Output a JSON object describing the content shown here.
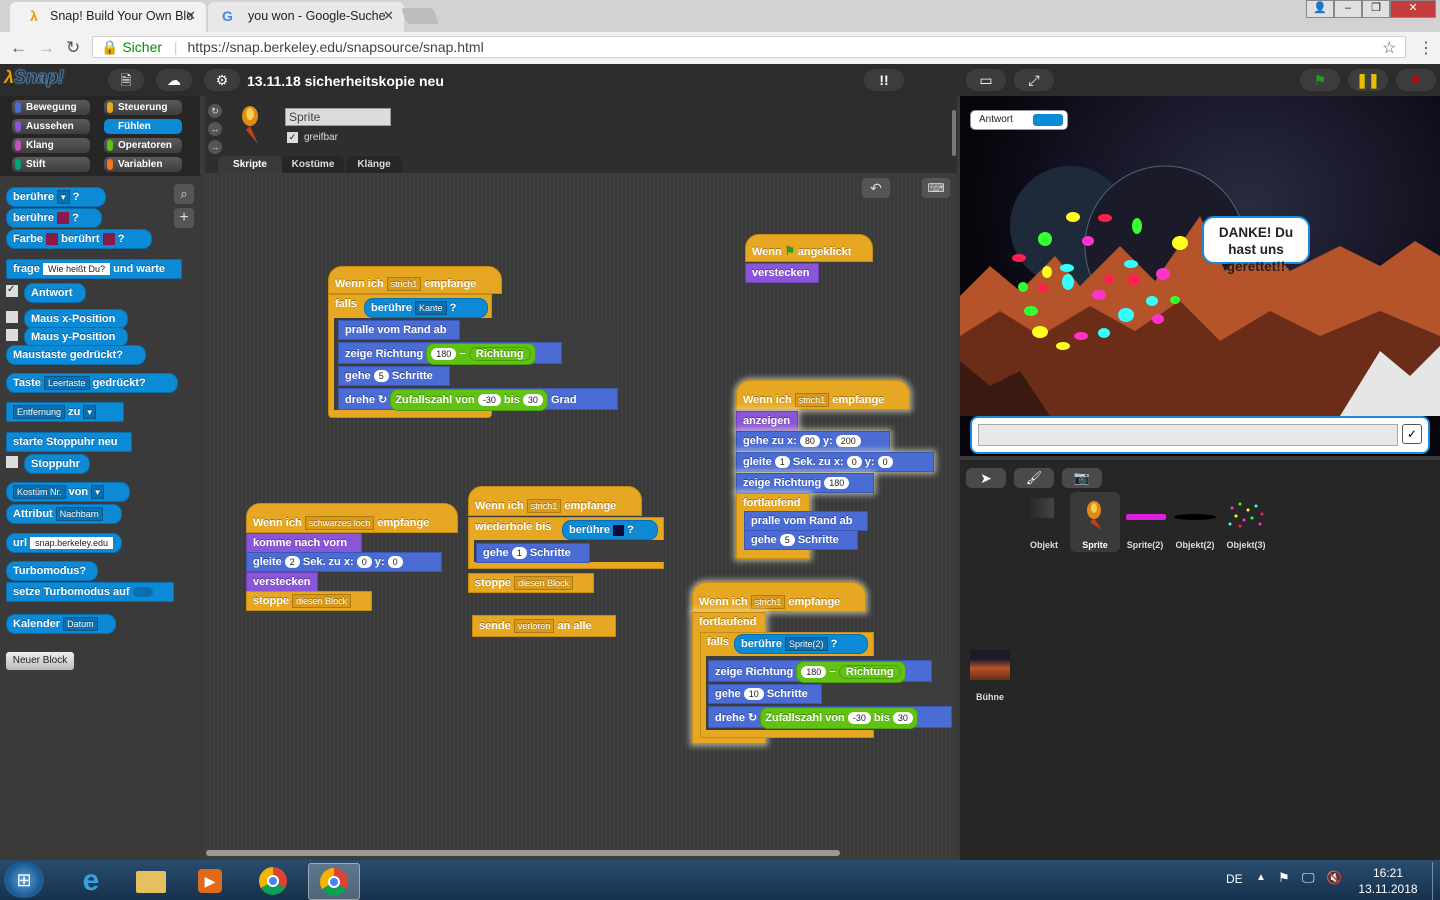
{
  "browser": {
    "tabs": [
      {
        "title": "Snap! Build Your Own Blo"
      },
      {
        "title": "you won - Google-Suche"
      }
    ],
    "security_label": "Sicher",
    "url": "https://snap.berkeley.edu/snapsource/snap.html"
  },
  "snap": {
    "logo": "Snap!",
    "project_title": "13.11.18 sicherheitskopie neu",
    "colors": {
      "green_flag": "#1fa01f",
      "pause": "#e6c000",
      "stop": "#cc0000"
    }
  },
  "categories": [
    {
      "label": "Bewegung",
      "color": "#4a6cd4"
    },
    {
      "label": "Steuerung",
      "color": "#e6a822"
    },
    {
      "label": "Aussehen",
      "color": "#8a55d7"
    },
    {
      "label": "Fühlen",
      "color": "#0d8ad6"
    },
    {
      "label": "Klang",
      "color": "#c94fbf"
    },
    {
      "label": "Operatoren",
      "color": "#62c213"
    },
    {
      "label": "Stift",
      "color": "#00a178"
    },
    {
      "label": "Variablen",
      "color": "#f3761d"
    }
  ],
  "palette": {
    "touching_1": "berühre",
    "touching_2": "berühre",
    "color_touching": "Farbe",
    "color_touching_2": "berührt",
    "q": "?",
    "ask": "frage",
    "ask_default": "Wie heißt Du?",
    "ask_wait": "und warte",
    "answer": "Antwort",
    "mouse_x": "Maus x-Position",
    "mouse_y": "Maus y-Position",
    "mouse_down": "Maustaste gedrückt?",
    "key": "Taste",
    "key_default": "Leertaste",
    "key_pressed": "gedrückt?",
    "distance": "Entfernung",
    "to": "zu",
    "reset_timer": "starte Stoppuhr neu",
    "timer": "Stoppuhr",
    "costume_nr": "Kostüm Nr.",
    "of": "von",
    "attribute": "Attribut",
    "neighbors": "Nachbarn",
    "url": "url",
    "url_default": "snap.berkeley.edu",
    "turbo": "Turbomodus?",
    "set_turbo": "setze Turbomodus auf",
    "date": "Kalender",
    "date_default": "Datum",
    "new_block": "Neuer Block"
  },
  "sprite": {
    "name": "Sprite",
    "draggable": "greifbar",
    "tabs": [
      "Skripte",
      "Kostüme",
      "Klänge"
    ]
  },
  "scripts": {
    "s1": {
      "hat": "Wenn ich",
      "msg": "strich1",
      "hat2": "empfange",
      "if": "falls",
      "touch": "berühre",
      "edge": "Kante",
      "q": "?",
      "bounce": "pralle vom Rand ab",
      "point": "zeige Richtung",
      "n180": "180",
      "minus": "−",
      "dir": "Richtung",
      "move": "gehe",
      "n5": "5",
      "steps": "Schritte",
      "turn": "drehe",
      "random": "Zufallszahl von",
      "nm30": "-30",
      "bis": "bis",
      "n30": "30",
      "deg": "Grad"
    },
    "s2": {
      "hat": "Wenn",
      "hat2": "angeklickt",
      "hide": "verstecken"
    },
    "s3": {
      "hat": "Wenn ich",
      "msg": "strich1",
      "hat2": "empfange",
      "show": "anzeigen",
      "goto": "gehe zu x:",
      "x": "80",
      "y_label": "y:",
      "y": "200",
      "glide": "gleite",
      "g1": "1",
      "secs": "Sek. zu x:",
      "gx": "0",
      "gy": "0",
      "point": "zeige Richtung",
      "d180": "180",
      "forever": "fortlaufend",
      "bounce": "pralle vom Rand ab",
      "move": "gehe",
      "n5": "5",
      "steps": "Schritte"
    },
    "s4": {
      "hat": "Wenn ich",
      "msg": "schwarzes loch",
      "hat2": "empfange",
      "front": "komme nach vorn",
      "glide": "gleite",
      "g2": "2",
      "secs": "Sek. zu x:",
      "gx": "0",
      "y_label": "y:",
      "gy": "0",
      "hide": "verstecken",
      "stop": "stoppe",
      "stop_opt": "diesen Block"
    },
    "s5": {
      "hat": "Wenn ich",
      "msg": "strich1",
      "hat2": "empfange",
      "repeat": "wiederhole bis",
      "touch": "berühre",
      "q": "?",
      "move": "gehe",
      "n1": "1",
      "steps": "Schritte",
      "stop": "stoppe",
      "stop_opt": "diesen Block"
    },
    "s6": {
      "send": "sende",
      "msg": "verloren",
      "to": "an alle"
    },
    "s7": {
      "hat": "Wenn ich",
      "msg": "strich1",
      "hat2": "empfange",
      "forever": "fortlaufend",
      "if": "falls",
      "touch": "berühre",
      "sprite": "Sprite(2)",
      "q": "?",
      "point": "zeige Richtung",
      "n180": "180",
      "minus": "−",
      "dir": "Richtung",
      "move": "gehe",
      "n10": "10",
      "steps": "Schritte",
      "turn": "drehe",
      "random": "Zufallszahl von",
      "nm30": "-30",
      "bis": "bis",
      "n30": "30"
    }
  },
  "stage": {
    "watcher_label": "Antwort",
    "speech": "DANKE! Du hast uns gerettet!!",
    "check": "✓"
  },
  "corral": {
    "sprites": [
      "Objekt",
      "Sprite",
      "Sprite(2)",
      "Objekt(2)",
      "Objekt(3)"
    ],
    "stage_label": "Bühne"
  },
  "taskbar": {
    "lang": "DE",
    "time": "16:21",
    "date": "13.11.2018"
  }
}
